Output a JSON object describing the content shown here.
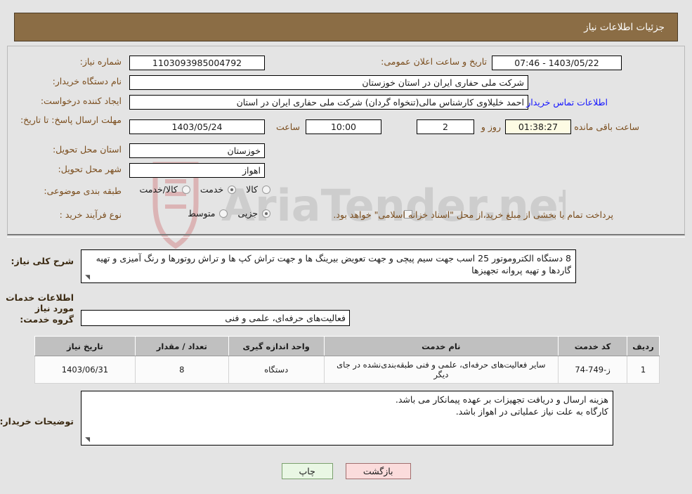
{
  "header": {
    "title": "جزئیات اطلاعات نیاز"
  },
  "form": {
    "need_number_label": "شماره نیاز:",
    "need_number_value": "1103093985004792",
    "announce_label": "تاریخ و ساعت اعلان عمومی:",
    "announce_value": "1403/05/22 - 07:46",
    "buyer_org_label": "نام دستگاه خریدار:",
    "buyer_org_value": "شرکت ملی حفاری ایران در استان خوزستان",
    "creator_label": "ایجاد کننده درخواست:",
    "creator_value": "احمد خلیلاوی کارشناس مالی(تنخواه گردان) شرکت ملی حفاری ایران در استان",
    "contact_link": "اطلاعات تماس خریدار",
    "deadline_label": "مهلت ارسال پاسخ: تا تاریخ:",
    "deadline_date": "1403/05/24",
    "hour_label": "ساعت",
    "deadline_time": "10:00",
    "days_value": "2",
    "days_label": "روز و",
    "countdown_value": "01:38:27",
    "remaining_label": "ساعت باقی مانده",
    "province_label": "استان محل تحویل:",
    "province_value": "خوزستان",
    "city_label": "شهر محل تحویل:",
    "city_value": "اهواز",
    "category_label": "طبقه بندی موضوعی:",
    "category_options": [
      {
        "label": "کالا",
        "selected": false
      },
      {
        "label": "خدمت",
        "selected": true
      },
      {
        "label": "کالا/خدمت",
        "selected": false
      }
    ],
    "process_label": "نوع فرآیند خرید :",
    "process_options": [
      {
        "label": "جزیی",
        "selected": true
      },
      {
        "label": "متوسط",
        "selected": false
      }
    ],
    "treasury_checkbox_checked": false,
    "treasury_note": "پرداخت تمام یا بخشی از مبلغ خرید،از محل \"اسناد خزانه اسلامی\" خواهد بود."
  },
  "description": {
    "label": "شرح کلی نیاز:",
    "text": "8 دستگاه الکتروموتور 25 اسب جهت سیم پیچی و جهت تعویض بیرینگ ها و جهت تراش کپ ها و تراش روتورها و رنگ آمیزی و تهیه گاردها و تهیه پروانه تجهیزها"
  },
  "services_section": {
    "heading": "اطلاعات خدمات مورد نیاز",
    "group_label": "گروه خدمت:",
    "group_value": "فعالیت‌های حرفه‌ای، علمی و فنی"
  },
  "table": {
    "headers": [
      "ردیف",
      "کد خدمت",
      "نام خدمت",
      "واحد اندازه گیری",
      "تعداد / مقدار",
      "تاریخ نیاز"
    ],
    "rows": [
      {
        "row_no": "1",
        "service_code": "ز-749-74",
        "service_name": "سایر فعالیت‌های حرفه‌ای، علمی و فنی طبقه‌بندی‌نشده در جای دیگر",
        "unit": "دستگاه",
        "quantity": "8",
        "need_date": "1403/06/31"
      }
    ]
  },
  "buyer_notes": {
    "label": "توضیحات خریدار:",
    "line1": "هزینه ارسال و دریافت تجهیزات بر عهده پیمانکار می باشد.",
    "line2": "کارگاه به علت نیاز عملیاتی در اهواز باشد."
  },
  "buttons": {
    "print": "چاپ",
    "back": "بازگشت"
  },
  "watermark": {
    "text": "AriaTender.net"
  },
  "colors": {
    "header_bg": "#8b6d45",
    "label": "#7a4d1d",
    "link": "#1414ff",
    "table_header_bg": "#c0c0c0",
    "print_btn_bg": "#e9f7e4",
    "back_btn_bg": "#fbdcdc"
  }
}
